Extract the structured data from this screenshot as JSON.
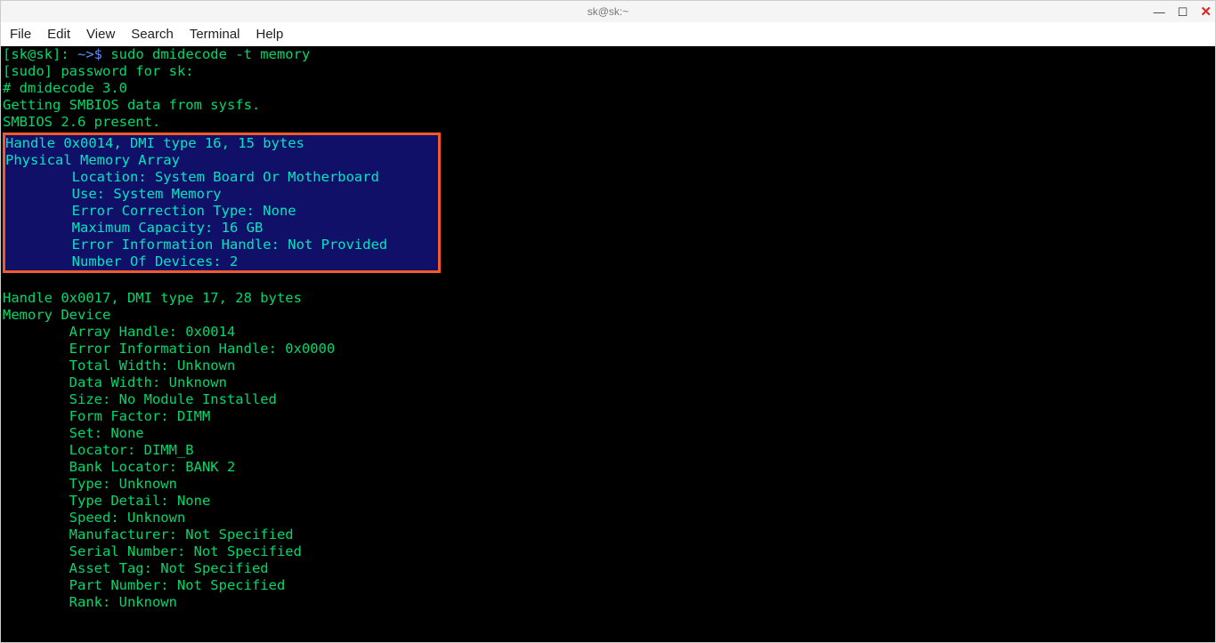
{
  "titlebar": {
    "title": "sk@sk:~"
  },
  "menu": {
    "file": "File",
    "edit": "Edit",
    "view": "View",
    "search": "Search",
    "terminal": "Terminal",
    "help": "Help"
  },
  "prompt": {
    "userhost": "[sk@sk]",
    "sep": ": ",
    "path": "~>$ ",
    "command": "sudo dmidecode -t memory"
  },
  "pre1": "[sudo] password for sk:\n# dmidecode 3.0\nGetting SMBIOS data from sysfs.\nSMBIOS 2.6 present.",
  "hl": "Handle 0x0014, DMI type 16, 15 bytes\nPhysical Memory Array\n        Location: System Board Or Motherboard\n        Use: System Memory\n        Error Correction Type: None\n        Maximum Capacity: 16 GB\n        Error Information Handle: Not Provided\n        Number Of Devices: 2",
  "post": "\nHandle 0x0017, DMI type 17, 28 bytes\nMemory Device\n        Array Handle: 0x0014\n        Error Information Handle: 0x0000\n        Total Width: Unknown\n        Data Width: Unknown\n        Size: No Module Installed\n        Form Factor: DIMM\n        Set: None\n        Locator: DIMM_B\n        Bank Locator: BANK 2\n        Type: Unknown\n        Type Detail: None\n        Speed: Unknown\n        Manufacturer: Not Specified\n        Serial Number: Not Specified\n        Asset Tag: Not Specified\n        Part Number: Not Specified\n        Rank: Unknown"
}
